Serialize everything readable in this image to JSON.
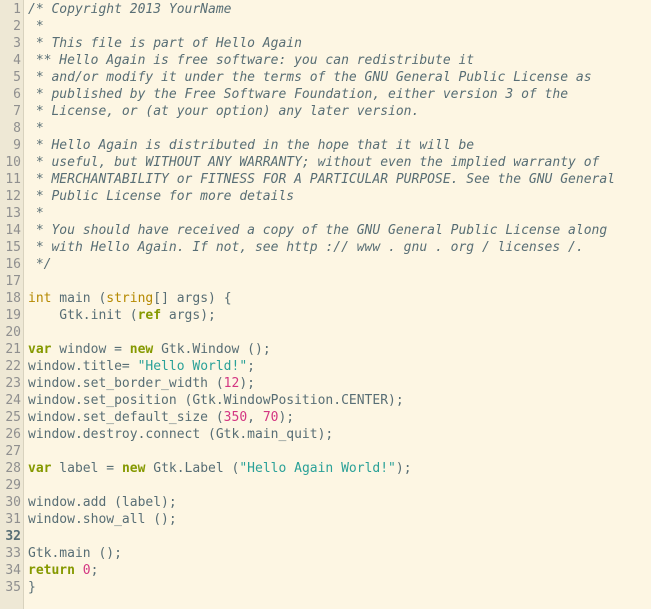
{
  "editor": {
    "theme_colors": {
      "background": "#fdf6e3",
      "gutter": "#eee8d5",
      "text": "#586e75",
      "keyword": "#859900",
      "type": "#b58900",
      "string": "#2aa198",
      "number": "#d33682"
    },
    "current_line": 32,
    "lines": [
      {
        "n": "1",
        "tokens": [
          {
            "c": "comment",
            "t": "/* Copyright 2013 YourName"
          }
        ]
      },
      {
        "n": "2",
        "tokens": [
          {
            "c": "comment",
            "t": " *"
          }
        ]
      },
      {
        "n": "3",
        "tokens": [
          {
            "c": "comment",
            "t": " * This file is part of Hello Again"
          }
        ]
      },
      {
        "n": "4",
        "tokens": [
          {
            "c": "comment",
            "t": " ** Hello Again is free software: you can redistribute it"
          }
        ]
      },
      {
        "n": "5",
        "tokens": [
          {
            "c": "comment",
            "t": " * and/or modify it under the terms of the GNU General Public License as"
          }
        ]
      },
      {
        "n": "6",
        "tokens": [
          {
            "c": "comment",
            "t": " * published by the Free Software Foundation, either version 3 of the"
          }
        ]
      },
      {
        "n": "7",
        "tokens": [
          {
            "c": "comment",
            "t": " * License, or (at your option) any later version."
          }
        ]
      },
      {
        "n": "8",
        "tokens": [
          {
            "c": "comment",
            "t": " *"
          }
        ]
      },
      {
        "n": "9",
        "tokens": [
          {
            "c": "comment",
            "t": " * Hello Again is distributed in the hope that it will be"
          }
        ]
      },
      {
        "n": "10",
        "tokens": [
          {
            "c": "comment",
            "t": " * useful, but WITHOUT ANY WARRANTY; without even the implied warranty of"
          }
        ]
      },
      {
        "n": "11",
        "tokens": [
          {
            "c": "comment",
            "t": " * MERCHANTABILITY or FITNESS FOR A PARTICULAR PURPOSE. See the GNU General"
          }
        ]
      },
      {
        "n": "12",
        "tokens": [
          {
            "c": "comment",
            "t": " * Public License for more details"
          }
        ]
      },
      {
        "n": "13",
        "tokens": [
          {
            "c": "comment",
            "t": " *"
          }
        ]
      },
      {
        "n": "14",
        "tokens": [
          {
            "c": "comment",
            "t": " * You should have received a copy of the GNU General Public License along"
          }
        ]
      },
      {
        "n": "15",
        "tokens": [
          {
            "c": "comment",
            "t": " * with Hello Again. If not, see http :// www . gnu . org / licenses /."
          }
        ]
      },
      {
        "n": "16",
        "tokens": [
          {
            "c": "comment",
            "t": " */"
          }
        ]
      },
      {
        "n": "17",
        "tokens": []
      },
      {
        "n": "18",
        "tokens": [
          {
            "c": "type",
            "t": "int"
          },
          {
            "c": "plain",
            "t": " main ("
          },
          {
            "c": "type",
            "t": "string"
          },
          {
            "c": "plain",
            "t": "[] args) {"
          }
        ]
      },
      {
        "n": "19",
        "tokens": [
          {
            "c": "plain",
            "t": "    Gtk.init ("
          },
          {
            "c": "keyword",
            "t": "ref"
          },
          {
            "c": "plain",
            "t": " args);"
          }
        ]
      },
      {
        "n": "20",
        "tokens": []
      },
      {
        "n": "21",
        "tokens": [
          {
            "c": "keyword",
            "t": "var"
          },
          {
            "c": "plain",
            "t": " window = "
          },
          {
            "c": "keyword",
            "t": "new"
          },
          {
            "c": "plain",
            "t": " Gtk.Window ();"
          }
        ]
      },
      {
        "n": "22",
        "tokens": [
          {
            "c": "plain",
            "t": "window.title= "
          },
          {
            "c": "string",
            "t": "\"Hello World!\""
          },
          {
            "c": "plain",
            "t": ";"
          }
        ]
      },
      {
        "n": "23",
        "tokens": [
          {
            "c": "plain",
            "t": "window.set_border_width ("
          },
          {
            "c": "number",
            "t": "12"
          },
          {
            "c": "plain",
            "t": ");"
          }
        ]
      },
      {
        "n": "24",
        "tokens": [
          {
            "c": "plain",
            "t": "window.set_position (Gtk.WindowPosition.CENTER);"
          }
        ]
      },
      {
        "n": "25",
        "tokens": [
          {
            "c": "plain",
            "t": "window.set_default_size ("
          },
          {
            "c": "number",
            "t": "350"
          },
          {
            "c": "plain",
            "t": ", "
          },
          {
            "c": "number",
            "t": "70"
          },
          {
            "c": "plain",
            "t": ");"
          }
        ]
      },
      {
        "n": "26",
        "tokens": [
          {
            "c": "plain",
            "t": "window.destroy.connect (Gtk.main_quit);"
          }
        ]
      },
      {
        "n": "27",
        "tokens": []
      },
      {
        "n": "28",
        "tokens": [
          {
            "c": "keyword",
            "t": "var"
          },
          {
            "c": "plain",
            "t": " label = "
          },
          {
            "c": "keyword",
            "t": "new"
          },
          {
            "c": "plain",
            "t": " Gtk.Label ("
          },
          {
            "c": "string",
            "t": "\"Hello Again World!\""
          },
          {
            "c": "plain",
            "t": ");"
          }
        ]
      },
      {
        "n": "29",
        "tokens": []
      },
      {
        "n": "30",
        "tokens": [
          {
            "c": "plain",
            "t": "window.add (label);"
          }
        ]
      },
      {
        "n": "31",
        "tokens": [
          {
            "c": "plain",
            "t": "window.show_all ();"
          }
        ]
      },
      {
        "n": "32",
        "tokens": []
      },
      {
        "n": "33",
        "tokens": [
          {
            "c": "plain",
            "t": "Gtk.main ();"
          }
        ]
      },
      {
        "n": "34",
        "tokens": [
          {
            "c": "keyword",
            "t": "return"
          },
          {
            "c": "plain",
            "t": " "
          },
          {
            "c": "number",
            "t": "0"
          },
          {
            "c": "plain",
            "t": ";"
          }
        ]
      },
      {
        "n": "35",
        "tokens": [
          {
            "c": "plain",
            "t": "}"
          }
        ]
      }
    ]
  }
}
